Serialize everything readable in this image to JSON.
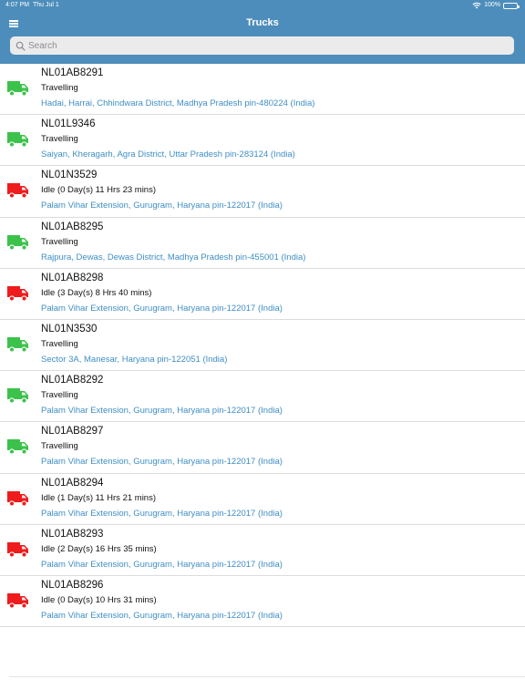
{
  "status_bar": {
    "time": "4:07 PM",
    "date": "Thu Jul 1",
    "battery": "100%"
  },
  "nav": {
    "title": "Trucks",
    "menu_icon": "hamburger-menu-icon"
  },
  "search": {
    "placeholder": "Search",
    "value": ""
  },
  "colors": {
    "header": "#4d8dbb",
    "travelling": "#3cc24b",
    "idle": "#ee1c1c",
    "address": "#3e8ec6"
  },
  "trucks": [
    {
      "plate": "NL01AB8291",
      "state": "Travelling",
      "status": "travelling",
      "address": "Hadai, Harrai, Chhindwara District, Madhya Pradesh pin-480224 (India)"
    },
    {
      "plate": "NL01L9346",
      "state": "Travelling",
      "status": "travelling",
      "address": "Saiyan, Kheragarh, Agra District, Uttar Pradesh pin-283124 (India)"
    },
    {
      "plate": "NL01N3529",
      "state": "Idle (0 Day(s) 11 Hrs 23 mins)",
      "status": "idle",
      "address": "Palam Vihar Extension, Gurugram, Haryana pin-122017 (India)"
    },
    {
      "plate": "NL01AB8295",
      "state": "Travelling",
      "status": "travelling",
      "address": "Rajpura, Dewas, Dewas District, Madhya Pradesh pin-455001 (India)"
    },
    {
      "plate": "NL01AB8298",
      "state": "Idle (3 Day(s) 8 Hrs 40 mins)",
      "status": "idle",
      "address": "Palam Vihar Extension, Gurugram, Haryana pin-122017 (India)"
    },
    {
      "plate": "NL01N3530",
      "state": "Travelling",
      "status": "travelling",
      "address": "Sector 3A, Manesar, Haryana pin-122051 (India)"
    },
    {
      "plate": "NL01AB8292",
      "state": "Travelling",
      "status": "travelling",
      "address": "Palam Vihar Extension, Gurugram, Haryana pin-122017 (India)"
    },
    {
      "plate": "NL01AB8297",
      "state": "Travelling",
      "status": "travelling",
      "address": "Palam Vihar Extension, Gurugram, Haryana pin-122017 (India)"
    },
    {
      "plate": "NL01AB8294",
      "state": "Idle (1 Day(s) 11 Hrs 21 mins)",
      "status": "idle",
      "address": "Palam Vihar Extension, Gurugram, Haryana pin-122017 (India)"
    },
    {
      "plate": "NL01AB8293",
      "state": "Idle (2 Day(s) 16 Hrs 35 mins)",
      "status": "idle",
      "address": "Palam Vihar Extension, Gurugram, Haryana pin-122017 (India)"
    },
    {
      "plate": "NL01AB8296",
      "state": "Idle (0 Day(s) 10 Hrs 31 mins)",
      "status": "idle",
      "address": "Palam Vihar Extension, Gurugram, Haryana pin-122017 (India)"
    }
  ]
}
